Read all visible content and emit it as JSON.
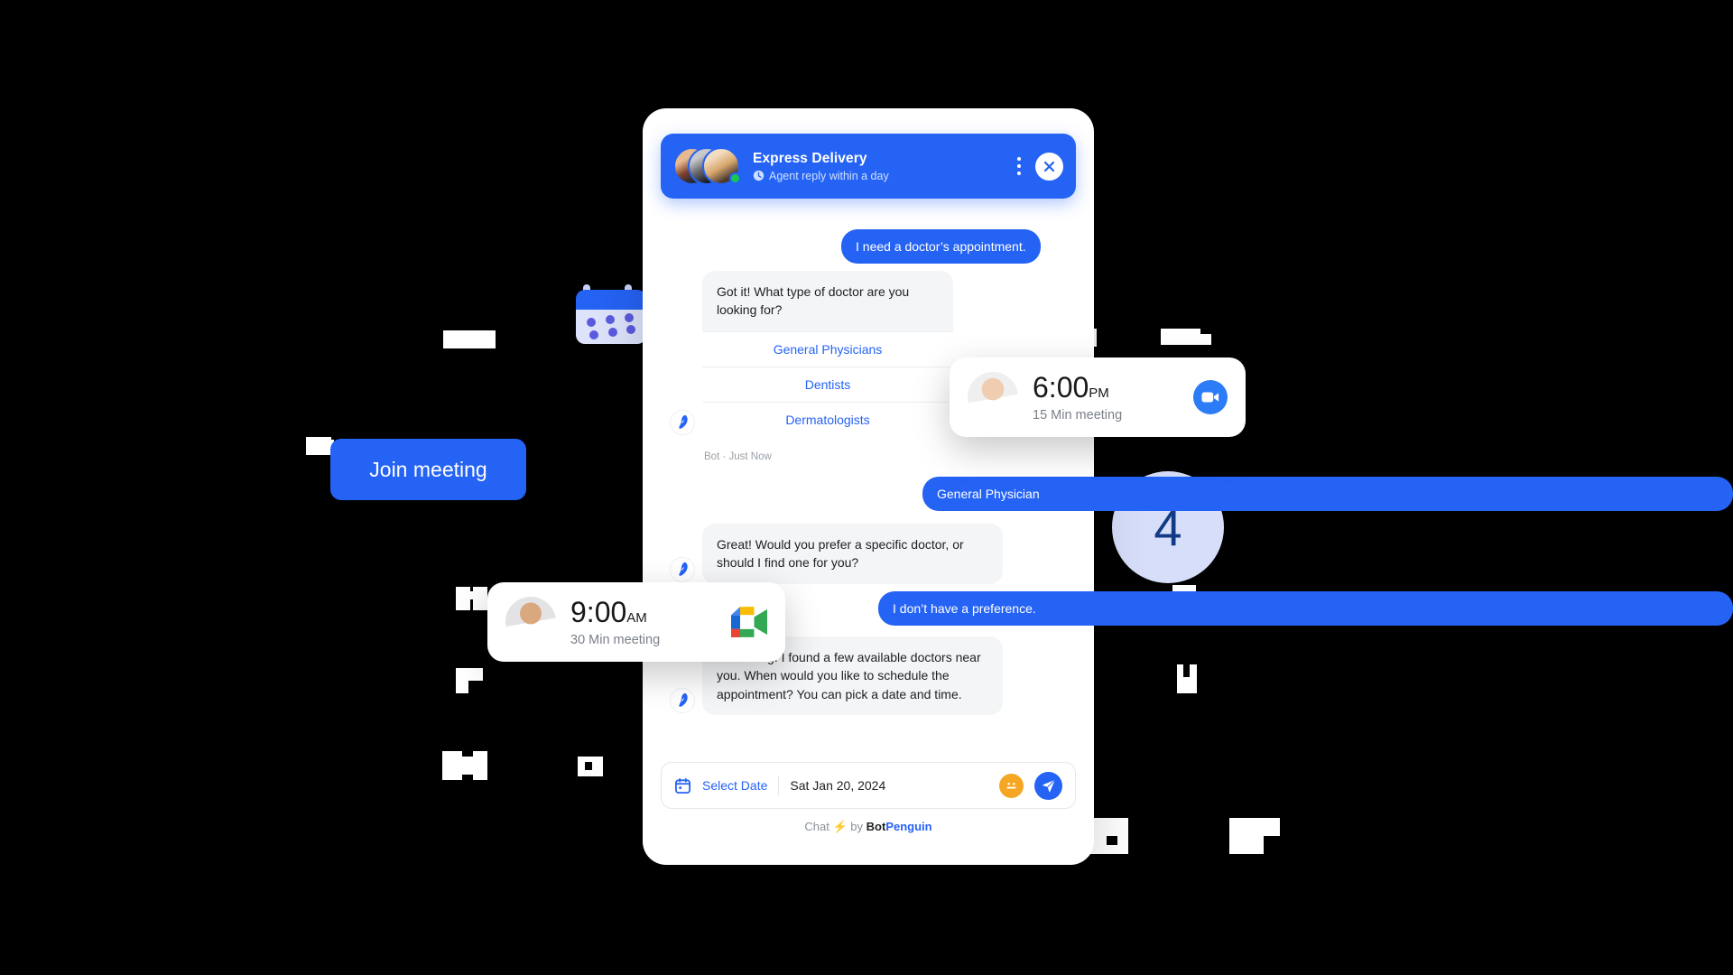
{
  "header": {
    "title": "Express Delivery",
    "subtitle": "Agent reply within a day",
    "clock_icon": "clock-icon",
    "menu_icon": "kebab-menu-icon",
    "close_icon": "close-icon",
    "online_status": "online",
    "accent_color": "#2563f5"
  },
  "conversation": [
    {
      "role": "user",
      "text": "I need a doctor’s appointment."
    },
    {
      "role": "bot",
      "text": "Got it! What type of doctor are you looking for?",
      "options": [
        "General Physicians",
        "Dentists",
        "Dermatologists"
      ],
      "meta": "Bot · Just Now"
    },
    {
      "role": "user",
      "text": "General Physician"
    },
    {
      "role": "bot",
      "text": "Great! Would you prefer a specific doctor, or should I find one for you?"
    },
    {
      "role": "user",
      "text": "I don’t have a preference."
    },
    {
      "role": "bot",
      "text": "Sure thing! I found a few available doctors near you. When would you like to schedule the appointment? You can pick a date and time."
    }
  ],
  "input_bar": {
    "calendar_icon": "calendar-icon",
    "select_date_label": "Select Date",
    "date_value": "Sat Jan 20, 2024",
    "emoji_icon": "smiley-icon",
    "send_icon": "send-icon"
  },
  "footer": {
    "prefix": "Chat",
    "bolt": "⚡",
    "by": "by",
    "brand_bot": "Bot",
    "brand_penguin": "Penguin"
  },
  "meeting_cards": [
    {
      "time": "6:00",
      "meridiem": "PM",
      "duration": "15 Min meeting",
      "action_icon": "video-camera-icon",
      "avatar": "female-doctor-avatar"
    },
    {
      "time": "9:00",
      "meridiem": "AM",
      "duration": "30 Min meeting",
      "action_icon": "google-meet-icon",
      "avatar": "male-doctor-avatar"
    }
  ],
  "join_meeting_button": {
    "label": "Join meeting"
  },
  "badge": {
    "value": "4"
  },
  "decor": {
    "calendar_icon": "calendar-icon"
  }
}
